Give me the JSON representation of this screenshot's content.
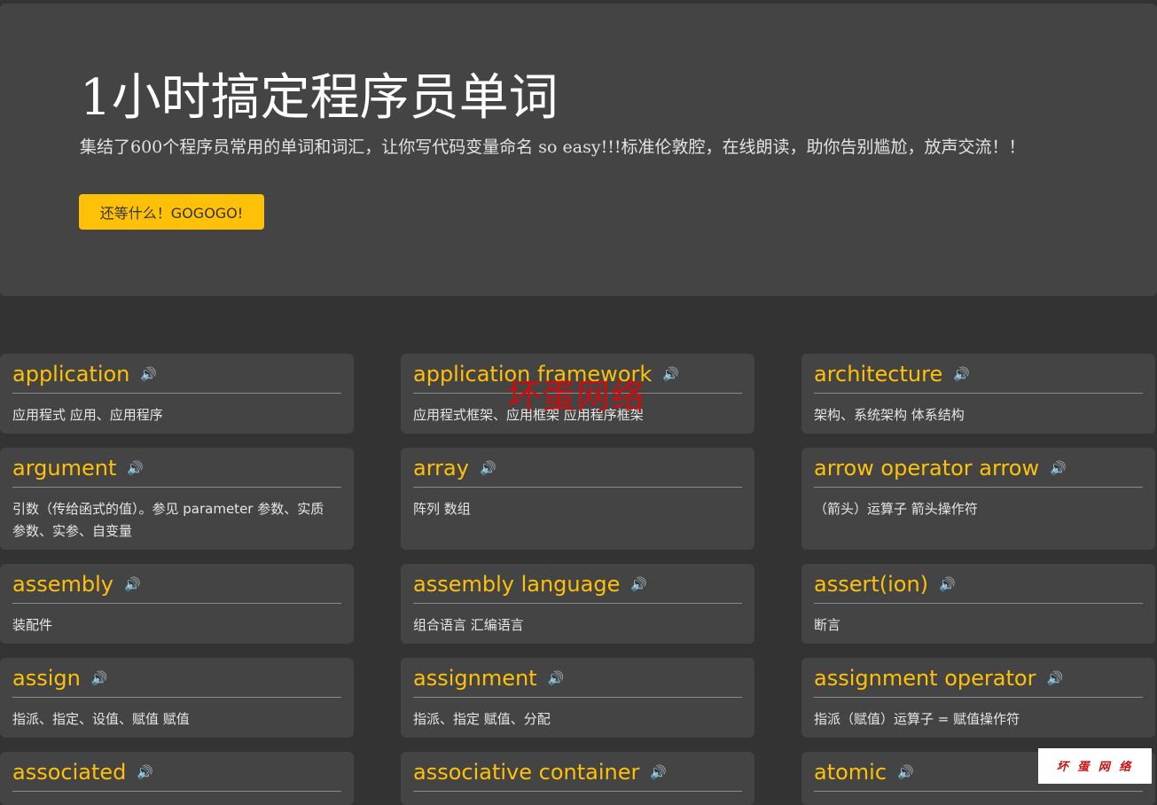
{
  "hero": {
    "title": "1小时搞定程序员单词",
    "subtitle": "集结了600个程序员常用的单词和词汇，让你写代码变量命名 so easy!!!标准伦敦腔，在线朗读，助你告别尴尬，放声交流！！",
    "cta": "还等什么！GOGOGO!"
  },
  "speaker_icon": "🔊",
  "cards": [
    {
      "word": "application",
      "meaning": "应用程式 应用、应用程序"
    },
    {
      "word": "application framework",
      "meaning": "应用程式框架、应用框架 应用程序框架"
    },
    {
      "word": "architecture",
      "meaning": "架构、系统架构 体系结构"
    },
    {
      "word": "argument",
      "meaning": "引数（传给函式的值）。参见 parameter 参数、实质参数、实参、自变量"
    },
    {
      "word": "array",
      "meaning": "阵列 数组"
    },
    {
      "word": "arrow operator arrow",
      "meaning": "（箭头）运算子 箭头操作符"
    },
    {
      "word": "assembly",
      "meaning": "装配件"
    },
    {
      "word": "assembly language",
      "meaning": "组合语言 汇编语言"
    },
    {
      "word": "assert(ion)",
      "meaning": "断言"
    },
    {
      "word": "assign",
      "meaning": "指派、指定、设值、赋值 赋值"
    },
    {
      "word": "assignment",
      "meaning": "指派、指定 赋值、分配"
    },
    {
      "word": "assignment operator",
      "meaning": "指派（赋值）运算子 = 赋值操作符"
    },
    {
      "word": "associated",
      "meaning": ""
    },
    {
      "word": "associative container",
      "meaning": ""
    },
    {
      "word": "atomic",
      "meaning": ""
    }
  ],
  "watermark": {
    "overlay": "坏蛋网络",
    "badge": "坏 蛋 网 络"
  },
  "colors": {
    "background": "#333333",
    "panel": "#444444",
    "accent": "#ffc107",
    "watermark": "#cc0d0d"
  }
}
